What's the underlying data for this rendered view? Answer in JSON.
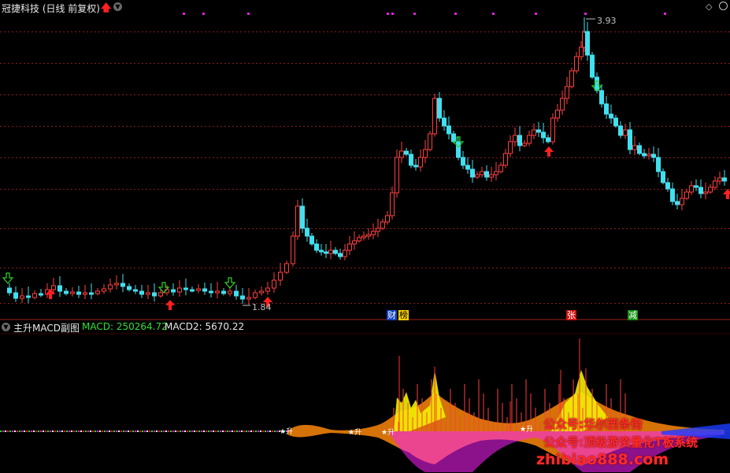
{
  "header": {
    "title": "冠捷科技 (日线 前复权)",
    "title_arrow_icon": "red-up-arrow-icon",
    "dropdown_icon": "chevron-down-icon",
    "corner_icons": [
      "diamond-icon",
      "circle-icon"
    ]
  },
  "price_panel": {
    "high_label": "3.93",
    "low_label": "1.84",
    "colors": {
      "up": "#ff4040",
      "down": "#40e0f0",
      "grid": "#8b1a1a",
      "buy_arrow": "#ff2020",
      "sell_arrow": "#30d030"
    }
  },
  "event_tags": {
    "cai": "财",
    "bang": "榜",
    "zhang": "张",
    "jian": "减"
  },
  "sub_panel": {
    "name": "主升MACD副图",
    "macd": "MACD: 250264.72",
    "macd2": "MACD2: 5670.22",
    "marker_text": "升"
  },
  "watermark": {
    "line1": "公众号:华尔西条街",
    "line2": "公众号:顶级游资量化T板系统",
    "line3": "zhibiao888.com"
  }
}
